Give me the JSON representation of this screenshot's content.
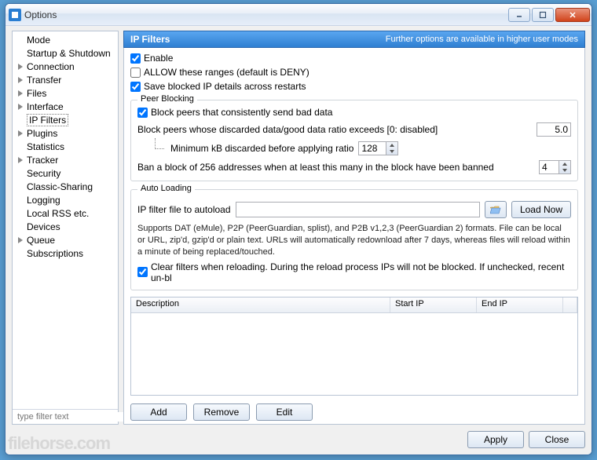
{
  "window": {
    "title": "Options"
  },
  "sidebar": {
    "items": [
      {
        "label": "Mode",
        "expandable": false,
        "level": 0
      },
      {
        "label": "Startup & Shutdown",
        "expandable": false,
        "level": 0
      },
      {
        "label": "Connection",
        "expandable": true,
        "level": 0
      },
      {
        "label": "Transfer",
        "expandable": true,
        "level": 0
      },
      {
        "label": "Files",
        "expandable": true,
        "level": 0
      },
      {
        "label": "Interface",
        "expandable": true,
        "level": 0
      },
      {
        "label": "IP Filters",
        "expandable": false,
        "level": 0,
        "selected": true
      },
      {
        "label": "Plugins",
        "expandable": true,
        "level": 0
      },
      {
        "label": "Statistics",
        "expandable": false,
        "level": 0
      },
      {
        "label": "Tracker",
        "expandable": true,
        "level": 0
      },
      {
        "label": "Security",
        "expandable": false,
        "level": 0
      },
      {
        "label": "Classic-Sharing",
        "expandable": false,
        "level": 0
      },
      {
        "label": "Logging",
        "expandable": false,
        "level": 0
      },
      {
        "label": "Local RSS etc.",
        "expandable": false,
        "level": 0
      },
      {
        "label": "Devices",
        "expandable": false,
        "level": 0
      },
      {
        "label": "Queue",
        "expandable": true,
        "level": 0
      },
      {
        "label": "Subscriptions",
        "expandable": false,
        "level": 0
      }
    ],
    "filter_placeholder": "type filter text"
  },
  "panel": {
    "title": "IP Filters",
    "hint": "Further options are available in higher user modes",
    "enable_label": "Enable",
    "enable_checked": true,
    "allow_label": "ALLOW these ranges (default is DENY)",
    "allow_checked": false,
    "save_label": "Save blocked IP details across restarts",
    "save_checked": true,
    "peer_blocking": {
      "legend": "Peer Blocking",
      "block_bad_label": "Block peers that consistently send bad data",
      "block_bad_checked": true,
      "ratio_label": "Block peers whose discarded data/good data ratio exceeds [0: disabled]",
      "ratio_value": "5.0",
      "min_kb_label": "Minimum kB discarded before applying ratio",
      "min_kb_value": "128",
      "ban_block_label": "Ban a block of 256 addresses when at least this many in the block have been banned",
      "ban_block_value": "4"
    },
    "auto_loading": {
      "legend": "Auto Loading",
      "file_label": "IP filter file to autoload",
      "file_value": "",
      "load_now": "Load Now",
      "help": "Supports DAT (eMule), P2P (PeerGuardian, splist), and P2B v1,2,3 (PeerGuardian 2) formats.  File can be local or URL, zip'd, gzip'd or plain text.  URLs will automatically redownload after 7 days, whereas files will reload within a minute of being replaced/touched.",
      "clear_label": "Clear filters when reloading. During the reload process IPs will not be blocked. If unchecked, recent un-bl",
      "clear_checked": true
    },
    "table": {
      "columns": [
        "Description",
        "Start IP",
        "End IP"
      ]
    },
    "actions": {
      "add": "Add",
      "remove": "Remove",
      "edit": "Edit"
    }
  },
  "footer": {
    "apply": "Apply",
    "close": "Close"
  },
  "watermark": "filehorse.com"
}
